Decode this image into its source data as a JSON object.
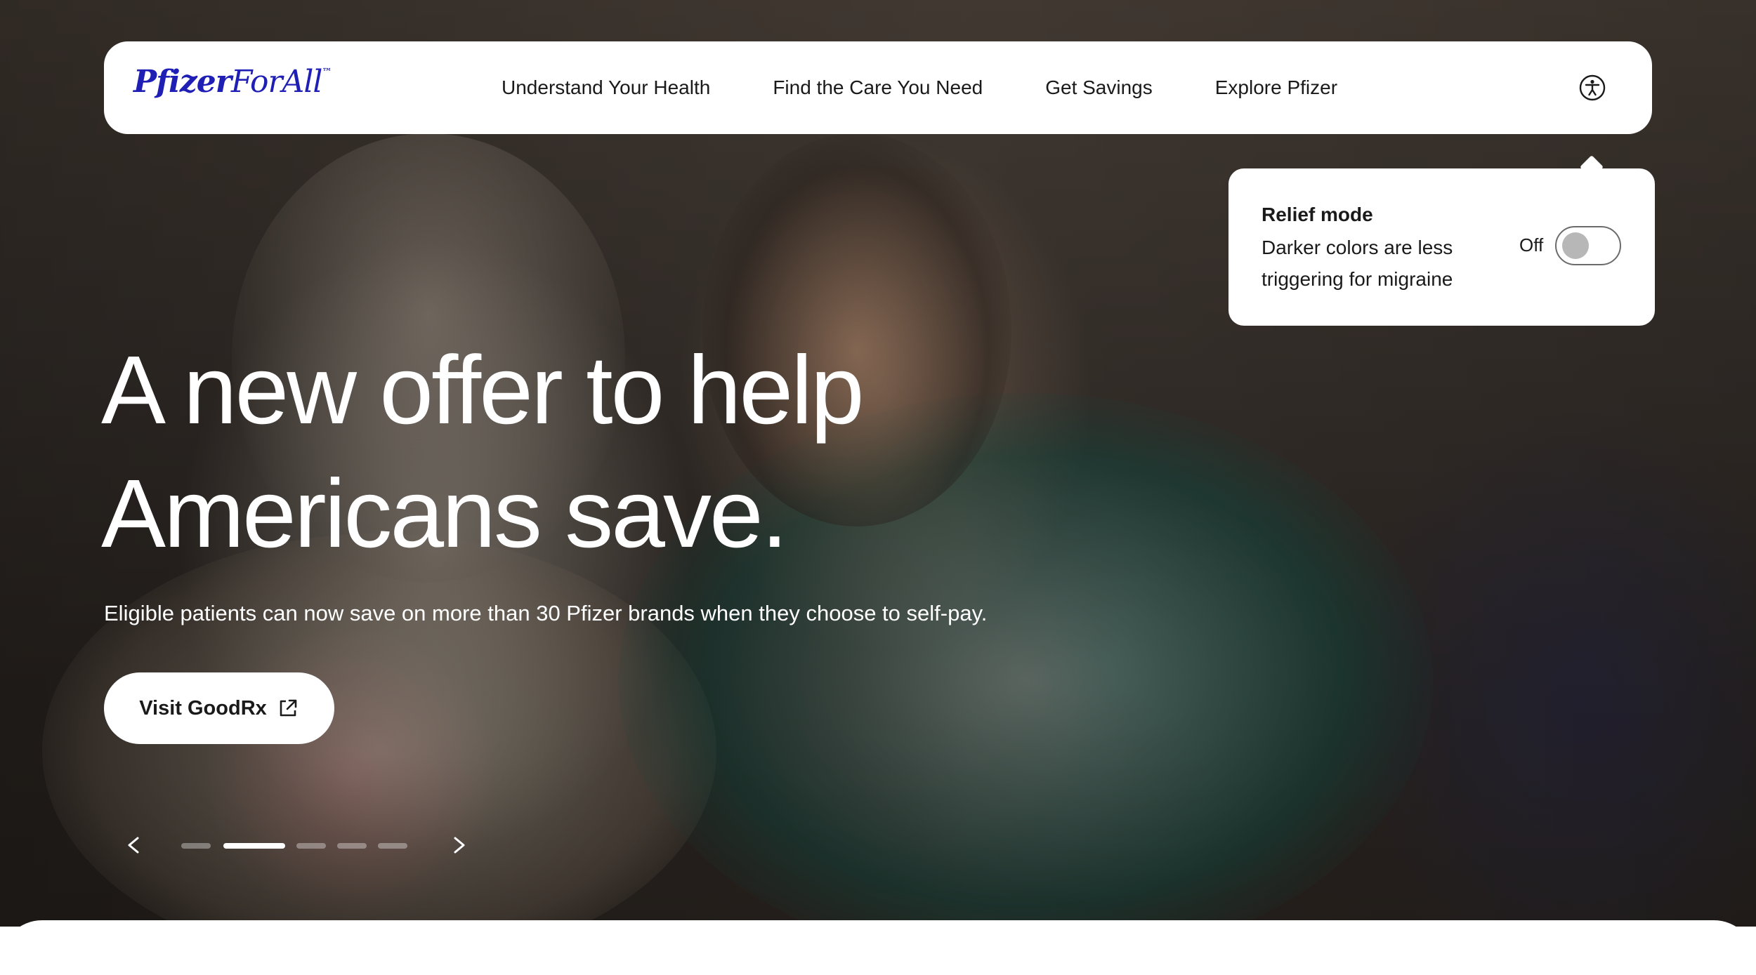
{
  "brand": {
    "logo_bold": "Pfizer",
    "logo_light": "ForAll",
    "logo_tm": "™",
    "color": "#1f1fb5"
  },
  "nav": {
    "items": [
      {
        "label": "Understand Your Health"
      },
      {
        "label": "Find the Care You Need"
      },
      {
        "label": "Get Savings"
      },
      {
        "label": "Explore Pfizer"
      }
    ],
    "accessibility_icon": "accessibility-icon"
  },
  "relief_mode": {
    "title": "Relief mode",
    "description": "Darker colors are less triggering for migraine",
    "state_label": "Off",
    "enabled": false
  },
  "hero": {
    "headline": "A new offer to help Americans save.",
    "subheadline": "Eligible patients can now save on more than 30 Pfizer brands when they choose to self-pay.",
    "cta_label": "Visit GoodRx",
    "cta_icon": "external-link-icon"
  },
  "carousel": {
    "prev_label": "<",
    "next_label": ">",
    "slide_count": 5,
    "active_slide": 2
  }
}
